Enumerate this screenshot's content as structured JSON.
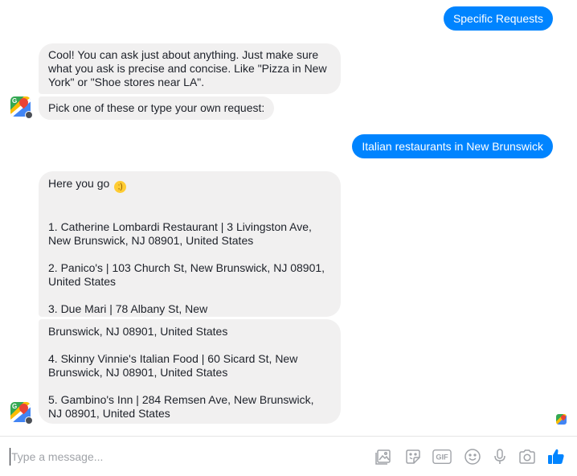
{
  "thread": {
    "out_messages": [
      "Specific Requests",
      "Italian restaurants in New Brunswick"
    ],
    "in_messages": {
      "intro": "Cool! You can ask just about anything. Just make sure what you ask is precise and concise. Like \"Pizza in New York\" or \"Shoe stores near LA\".",
      "pick": "Pick one of these or type your own request:",
      "here_you_go": "Here you go",
      "results": {
        "r1a": "1. Catherine Lombardi Restaurant | 3 Livingston Ave,",
        "r1b": "New Brunswick, NJ 08901, United States",
        "r2a": "2. Panico's | 103 Church St, New Brunswick, NJ 08901,",
        "r2b": "United States",
        "r3a": "3. Due Mari | 78 Albany St, New",
        "r3b": "Brunswick, NJ 08901, United States",
        "r4a": "4. Skinny Vinnie's Italian Food | 60 Sicard St, New",
        "r4b": "Brunswick, NJ 08901, United States",
        "r5a": "5. Gambino's Inn | 284 Remsen Ave, New Brunswick,",
        "r5b": "NJ 08901, United States"
      }
    },
    "emoji": "wink-emoji",
    "avatar_icon": "google-maps-icon"
  },
  "composer": {
    "placeholder": "Type a message...",
    "tools": [
      "image-icon",
      "sticker-icon",
      "gif-icon",
      "emoji-icon",
      "microphone-icon",
      "camera-icon",
      "thumbs-up-icon"
    ],
    "gif_label": "GIF"
  },
  "colors": {
    "outgoing": "#0084ff",
    "incoming": "#f1f0f0",
    "icon": "#a0a3a8"
  }
}
